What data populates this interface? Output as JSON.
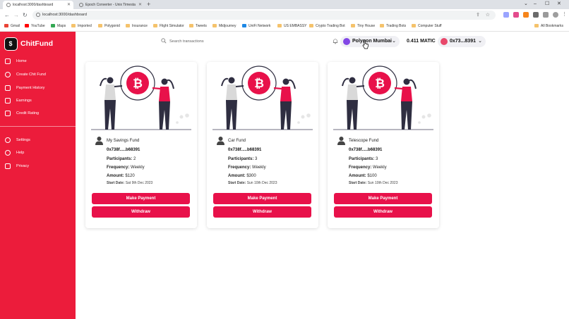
{
  "browser": {
    "tabs": [
      {
        "title": "localhost:3000/dashboard",
        "active": true
      },
      {
        "title": "Epoch Converter - Unix Timesta",
        "active": false
      }
    ],
    "url": "localhost:3000/dashboard",
    "bookmarks": [
      "Gmail",
      "YouTube",
      "Maps",
      "Imported",
      "Polygonid",
      "Insurance",
      "Flight Simulator",
      "Tweets",
      "Midjourney",
      "UniFi Network",
      "US EMBASSY",
      "Crypto Trading Bot",
      "Tiny House",
      "Trading Bots",
      "Computer Stuff"
    ],
    "all_bookmarks": "All Bookmarks"
  },
  "app": {
    "name": "ChitFund",
    "logo_glyph": "$",
    "accent_color": "#ec1c3b",
    "button_color": "#e8114a"
  },
  "sidebar": {
    "items": [
      {
        "label": "Home",
        "icon": "home-icon"
      },
      {
        "label": "Create Chit Fund",
        "icon": "plus-circle-icon"
      },
      {
        "label": "Payment History",
        "icon": "receipt-icon"
      },
      {
        "label": "Earnings",
        "icon": "wallet-icon"
      },
      {
        "label": "Credit Rating",
        "icon": "calculator-icon"
      }
    ],
    "secondary": [
      {
        "label": "Settings",
        "icon": "gear-icon"
      },
      {
        "label": "Help",
        "icon": "help-icon"
      },
      {
        "label": "Privacy",
        "icon": "shield-icon"
      }
    ]
  },
  "topbar": {
    "search_placeholder": "Search transactions",
    "network": "Polygon Mumbai",
    "balance": "0.411 MATIC",
    "account": "0x73...8391"
  },
  "funds": [
    {
      "name": "My Savings Fund",
      "address": "0x738f.....b68391",
      "participants_label": "Participants:",
      "participants": "2",
      "frequency_label": "Frequency:",
      "frequency": "Weekly",
      "amount_label": "Amount:",
      "amount": "$120",
      "start_label": "Start Date:",
      "start_date": "Sat 9th Dec 2023",
      "pay_label": "Make Payment",
      "withdraw_label": "Withdraw"
    },
    {
      "name": "Car Fund",
      "address": "0x738f.....b68391",
      "participants_label": "Participants:",
      "participants": "3",
      "frequency_label": "Frequency:",
      "frequency": "Weekly",
      "amount_label": "Amount:",
      "amount": "$300",
      "start_label": "Start Date:",
      "start_date": "Sun 10th Dec 2023",
      "pay_label": "Make Payment",
      "withdraw_label": "Withdraw"
    },
    {
      "name": "Telescope Fund",
      "address": "0x738f.....b68391",
      "participants_label": "Participants:",
      "participants": "3",
      "frequency_label": "Frequency:",
      "frequency": "Weekly",
      "amount_label": "Amount:",
      "amount": "$100",
      "start_label": "Start Date:",
      "start_date": "Sun 10th Dec 2023",
      "pay_label": "Make Payment",
      "withdraw_label": "Withdraw"
    }
  ]
}
